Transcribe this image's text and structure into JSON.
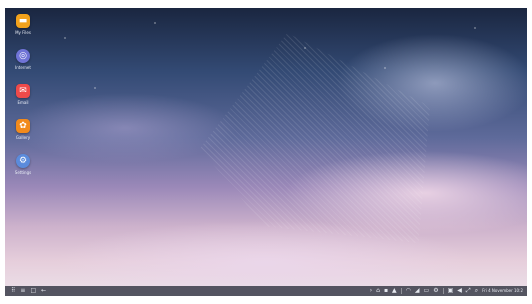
{
  "desktop": {
    "icons": [
      {
        "name": "My Files",
        "icon": "folder-icon",
        "color": "#f2a21c"
      },
      {
        "name": "Internet",
        "icon": "internet-icon",
        "color": "#6f73d6"
      },
      {
        "name": "Email",
        "icon": "email-icon",
        "color": "#ef4a4a"
      },
      {
        "name": "Gallery",
        "icon": "gallery-icon",
        "color": "#f28a1c"
      },
      {
        "name": "Settings",
        "icon": "settings-icon",
        "color": "#5b8bdc"
      }
    ]
  },
  "taskbar": {
    "left": [
      {
        "icon": "apps-grid-icon",
        "glyph": "⠿"
      },
      {
        "icon": "recent-apps-icon",
        "glyph": "≡"
      },
      {
        "icon": "home-icon",
        "glyph": "□"
      },
      {
        "icon": "back-icon",
        "glyph": "←"
      }
    ],
    "right": [
      {
        "icon": "chevron-icon",
        "glyph": "›"
      },
      {
        "icon": "notification-icon",
        "glyph": "⌂"
      },
      {
        "icon": "notification-2-icon",
        "glyph": "▪"
      },
      {
        "icon": "notification-3-icon",
        "glyph": "▲"
      },
      {
        "icon": "wifi-icon",
        "glyph": "◠"
      },
      {
        "icon": "signal-icon",
        "glyph": "◢"
      },
      {
        "icon": "battery-icon",
        "glyph": "▭"
      },
      {
        "icon": "settings-quick-icon",
        "glyph": "⚙"
      },
      {
        "icon": "screenshot-icon",
        "glyph": "▣"
      },
      {
        "icon": "volume-icon",
        "glyph": "◀"
      },
      {
        "icon": "fullscreen-icon",
        "glyph": "⤢"
      },
      {
        "icon": "search-icon",
        "glyph": "⌕"
      }
    ],
    "clock": "Fri 4 November 10:2"
  }
}
